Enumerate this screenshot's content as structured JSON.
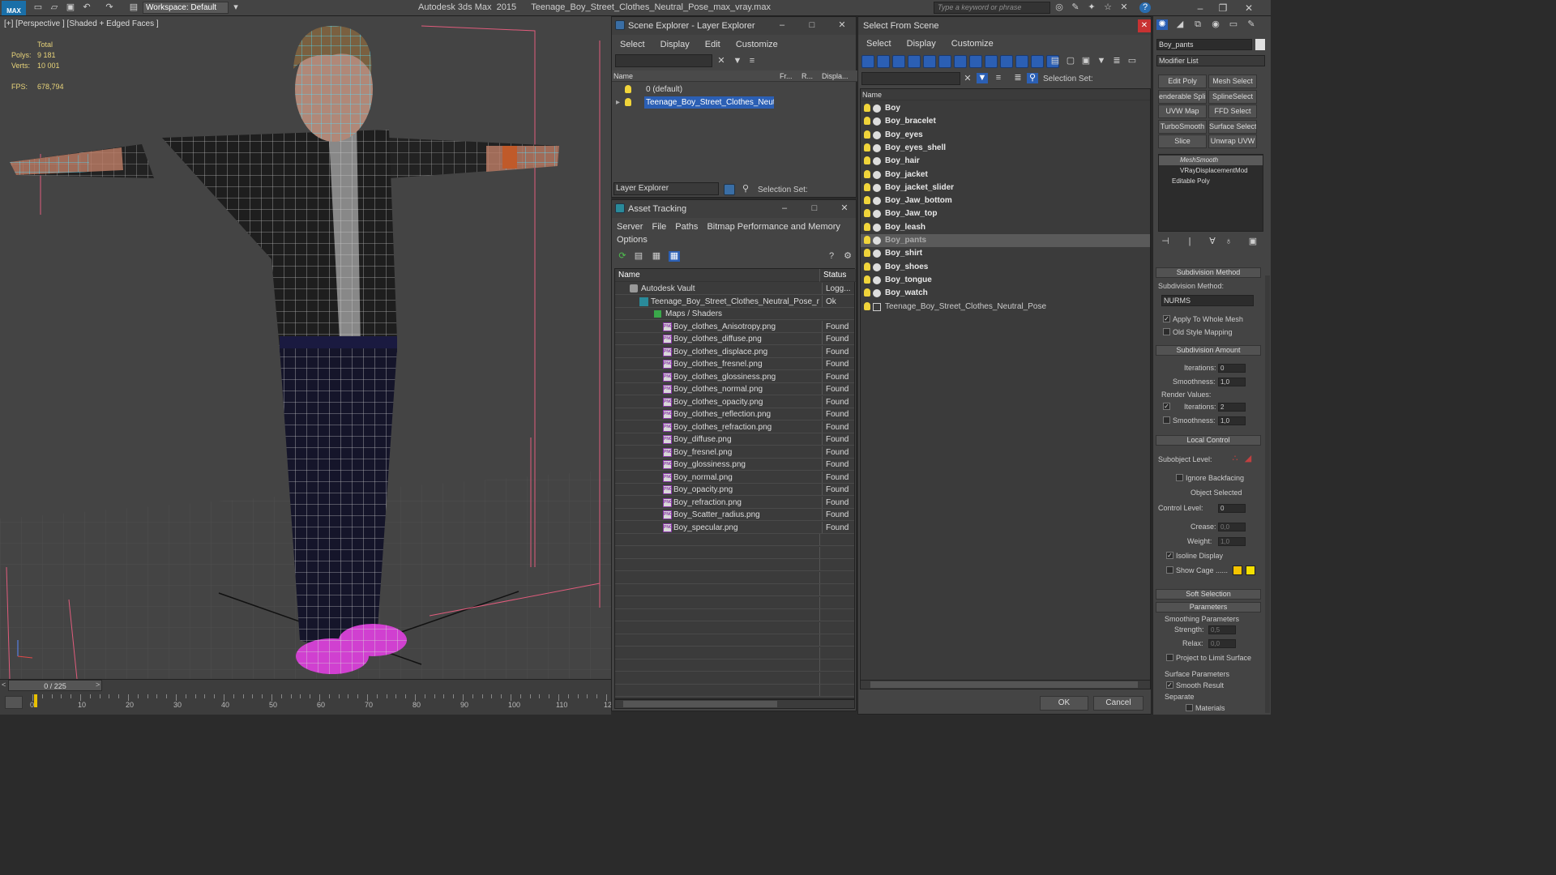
{
  "app": {
    "logo": "MAX",
    "workspace": "Workspace: Default",
    "title": "Autodesk 3ds Max  2015      Teenage_Boy_Street_Clothes_Neutral_Pose_max_vray.max",
    "search_placeholder": "Type a keyword or phrase"
  },
  "viewport": {
    "label": "[+] [Perspective ] [Shaded + Edged Faces ]",
    "stats": {
      "total": "Total",
      "polys_label": "Polys:",
      "polys": "9 181",
      "verts_label": "Verts:",
      "verts": "10 001",
      "fps_label": "FPS:",
      "fps": "678,794"
    }
  },
  "timeline": {
    "frame": "0 / 225",
    "ticks": [
      "0",
      "10",
      "20",
      "30",
      "40",
      "50",
      "60",
      "70",
      "80",
      "90",
      "100",
      "110",
      "12"
    ]
  },
  "scene_explorer": {
    "title": "Scene Explorer - Layer Explorer",
    "menu": [
      "Select",
      "Display",
      "Edit",
      "Customize"
    ],
    "columns": [
      "Name",
      "Fr...",
      "R...",
      "Displa..."
    ],
    "rows": [
      "0 (default)",
      "Teenage_Boy_Street_Clothes_Neutr..."
    ],
    "footer_dropdown": "Layer Explorer",
    "selection_set": "Selection Set:"
  },
  "asset_tracking": {
    "title": "Asset Tracking",
    "menu": [
      "Server",
      "File",
      "Paths",
      "Bitmap Performance and Memory"
    ],
    "menu2": "Options",
    "columns": [
      "Name",
      "Status"
    ],
    "rows": [
      {
        "name": "Autodesk Vault",
        "status": "Logg...",
        "indent": 0
      },
      {
        "name": "Teenage_Boy_Street_Clothes_Neutral_Pose_m...",
        "status": "Ok",
        "indent": 1
      },
      {
        "name": "Maps / Shaders",
        "status": "",
        "indent": 2
      },
      {
        "name": "Boy_clothes_Anisotropy.png",
        "status": "Found",
        "indent": 3
      },
      {
        "name": "Boy_clothes_diffuse.png",
        "status": "Found",
        "indent": 3
      },
      {
        "name": "Boy_clothes_displace.png",
        "status": "Found",
        "indent": 3
      },
      {
        "name": "Boy_clothes_fresnel.png",
        "status": "Found",
        "indent": 3
      },
      {
        "name": "Boy_clothes_glossiness.png",
        "status": "Found",
        "indent": 3
      },
      {
        "name": "Boy_clothes_normal.png",
        "status": "Found",
        "indent": 3
      },
      {
        "name": "Boy_clothes_opacity.png",
        "status": "Found",
        "indent": 3
      },
      {
        "name": "Boy_clothes_reflection.png",
        "status": "Found",
        "indent": 3
      },
      {
        "name": "Boy_clothes_refraction.png",
        "status": "Found",
        "indent": 3
      },
      {
        "name": "Boy_diffuse.png",
        "status": "Found",
        "indent": 3
      },
      {
        "name": "Boy_fresnel.png",
        "status": "Found",
        "indent": 3
      },
      {
        "name": "Boy_glossiness.png",
        "status": "Found",
        "indent": 3
      },
      {
        "name": "Boy_normal.png",
        "status": "Found",
        "indent": 3
      },
      {
        "name": "Boy_opacity.png",
        "status": "Found",
        "indent": 3
      },
      {
        "name": "Boy_refraction.png",
        "status": "Found",
        "indent": 3
      },
      {
        "name": "Boy_Scatter_radius.png",
        "status": "Found",
        "indent": 3
      },
      {
        "name": "Boy_specular.png",
        "status": "Found",
        "indent": 3
      }
    ]
  },
  "select_from_scene": {
    "title": "Select From Scene",
    "menu": [
      "Select",
      "Display",
      "Customize"
    ],
    "selection_set": "Selection Set:",
    "column": "Name",
    "items": [
      "Boy",
      "Boy_bracelet",
      "Boy_eyes",
      "Boy_eyes_shell",
      "Boy_hair",
      "Boy_jacket",
      "Boy_jacket_slider",
      "Boy_Jaw_bottom",
      "Boy_Jaw_top",
      "Boy_leash",
      "Boy_pants",
      "Boy_shirt",
      "Boy_shoes",
      "Boy_tongue",
      "Boy_watch"
    ],
    "group_item": "Teenage_Boy_Street_Clothes_Neutral_Pose",
    "selected": "Boy_pants",
    "ok": "OK",
    "cancel": "Cancel"
  },
  "command_panel": {
    "object_name": "Boy_pants",
    "modifier_list": "Modifier List",
    "buttons": [
      "Edit Poly",
      "Mesh Select",
      "enderable Splir",
      "SplineSelect",
      "UVW Map",
      "FFD Select",
      "TurboSmooth",
      "Surface Select",
      "Slice",
      "Unwrap UVW"
    ],
    "stack": [
      "MeshSmooth",
      "VRayDisplacementMod",
      "Editable Poly"
    ],
    "subdivision_method": {
      "title": "Subdivision Method",
      "label": "Subdivision Method:",
      "value": "NURMS",
      "apply": "Apply To Whole Mesh",
      "old": "Old Style Mapping"
    },
    "subdivision_amount": {
      "title": "Subdivision Amount",
      "iterations_label": "Iterations:",
      "iterations": "0",
      "smoothness_label": "Smoothness:",
      "smoothness": "1,0",
      "render_values": "Render Values:",
      "r_iterations": "2",
      "r_smoothness": "1,0"
    },
    "local_control": {
      "title": "Local Control",
      "subobject": "Subobject Level:",
      "ignore": "Ignore Backfacing",
      "object_selected": "Object Selected",
      "control_level_label": "Control Level:",
      "control_level": "0",
      "crease_label": "Crease:",
      "crease": "0,0",
      "weight_label": "Weight:",
      "weight": "1,0",
      "isoline": "Isoline Display",
      "show_cage": "Show Cage ......"
    },
    "soft_selection": "Soft Selection",
    "parameters": {
      "title": "Parameters",
      "smoothing": "Smoothing Parameters",
      "strength_label": "Strength:",
      "strength": "0,5",
      "relax_label": "Relax:",
      "relax": "0,0",
      "project": "Project to Limit Surface",
      "surface": "Surface Parameters",
      "smooth_result": "Smooth Result",
      "separate": "Separate",
      "materials": "Materials"
    }
  },
  "colors": {
    "selected_blue": "#2b5fb4",
    "bulb": "#f0d43a",
    "cage_yellow": "#f5c400",
    "wire": "#4fe0ff",
    "viewport_bg": "#444444"
  }
}
